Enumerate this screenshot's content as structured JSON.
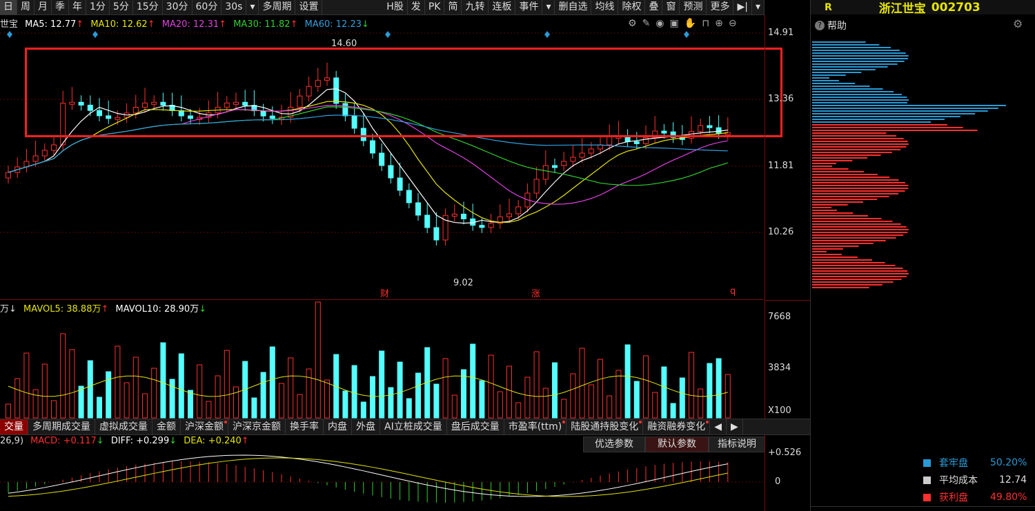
{
  "toolbar": {
    "left_items": [
      "日",
      "周",
      "月",
      "季",
      "年",
      "1分",
      "5分",
      "15分",
      "30分",
      "60分",
      "30s",
      "▾",
      "多周期",
      "设置"
    ],
    "right_items": [
      "H股",
      "发",
      "PK",
      "简",
      "九转",
      "连板",
      "事件",
      "▾",
      "删自选",
      "均线",
      "除权",
      "叠",
      "窗",
      "预测",
      "更多",
      "▶|",
      "▾"
    ]
  },
  "stock": {
    "prefix": "R",
    "name": "浙江世宝",
    "code": "002703"
  },
  "ma_legend": {
    "name_tail": "世宝",
    "ma5": "MA5: 12.77",
    "ma5_arrow": "↑",
    "ma10": "MA10: 12.62",
    "ma10_arrow": "↑",
    "ma20": "MA20: 12.31",
    "ma20_arrow": "↑",
    "ma30": "MA30: 11.82",
    "ma30_arrow": "↑",
    "ma60": "MA60: 12.23",
    "ma60_arrow": "↓"
  },
  "price_axis": [
    "14.91",
    "13.36",
    "11.81",
    "10.26"
  ],
  "annotations": {
    "high": "14.60",
    "low": "9.02",
    "event1": "财",
    "event2": "涨",
    "event3": "q"
  },
  "volume": {
    "label_tail": "万↓",
    "mavol5": "MAVOL5: 38.88万",
    "mavol5_arrow": "↑",
    "mavol10": "MAVOL10: 28.90万",
    "mavol10_arrow": "↓",
    "axis": [
      "7668",
      "3834",
      "X100"
    ]
  },
  "tabs": [
    "交量",
    "多周期成交量",
    "虚拟成交量",
    "金额",
    "沪深金额",
    "沪深京金额",
    "换手率",
    "内盘",
    "外盘",
    "AI立桩成交量",
    "盘后成交量",
    "市盈率(ttm)",
    "陆股通持股变化",
    "融资融券变化"
  ],
  "tab_dots": [
    false,
    false,
    false,
    false,
    true,
    false,
    false,
    false,
    false,
    false,
    false,
    true,
    true,
    true
  ],
  "macd": {
    "params": "26,9)",
    "macd": "MACD: +0.117",
    "macd_arrow": "↓",
    "diff": "DIFF: +0.299",
    "diff_arrow": "↓",
    "dea": "DEA: +0.240",
    "dea_arrow": "↑",
    "axis": [
      "+0.526",
      "0"
    ],
    "buttons": [
      "优选参数",
      "默认参数",
      "指标说明"
    ]
  },
  "right_panel": {
    "help": "帮助",
    "legend": [
      {
        "label": "套牢盘",
        "value": "50.20%",
        "color": "#2a9bd6"
      },
      {
        "label": "平均成本",
        "value": "12.74",
        "color": "#cccccc"
      },
      {
        "label": "获利盘",
        "value": "49.80%",
        "color": "#ff3030"
      }
    ]
  },
  "colors": {
    "up": "#ff3030",
    "down": "#54ffff",
    "ma5": "#ffffff",
    "ma10": "#e6e600",
    "ma20": "#e040e0",
    "ma30": "#30d030",
    "ma60": "#30a0e0",
    "frame": "#ff2020"
  }
}
